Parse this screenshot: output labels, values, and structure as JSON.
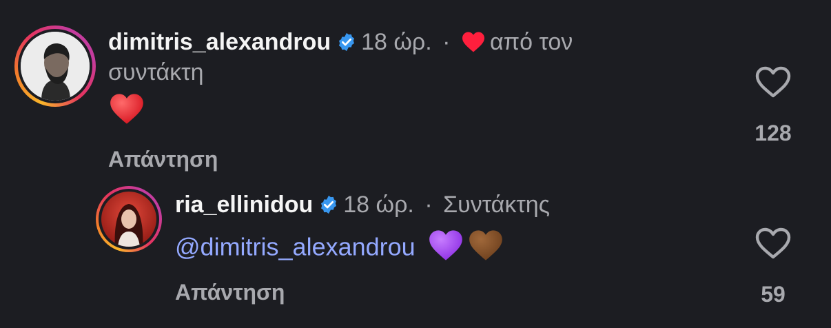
{
  "comments": [
    {
      "username": "dimitris_alexandrou",
      "time": "18 ώρ.",
      "separator": "·",
      "liked_by_author_text": "από τον",
      "liked_by_author_text_2": "συντάκτη",
      "body_emoji": "❤️",
      "reply_label": "Απάντηση",
      "like_count": "128"
    },
    {
      "username": "ria_ellinidou",
      "time": "18 ώρ.",
      "separator": "·",
      "role_label": "Συντάκτης",
      "mention": "@dimitris_alexandrou",
      "body_emojis": "💜🤎",
      "reply_label": "Απάντηση",
      "like_count": "59"
    }
  ],
  "colors": {
    "background": "#1c1d22",
    "verified_badge": "#3897f0",
    "mention": "#94a9ff",
    "meta_text": "#a8a9ae",
    "author_heart": "#ff1f3d"
  },
  "icons": {
    "verified": "verified-badge-icon",
    "like": "heart-outline-icon",
    "author_like": "heart-filled-icon"
  }
}
